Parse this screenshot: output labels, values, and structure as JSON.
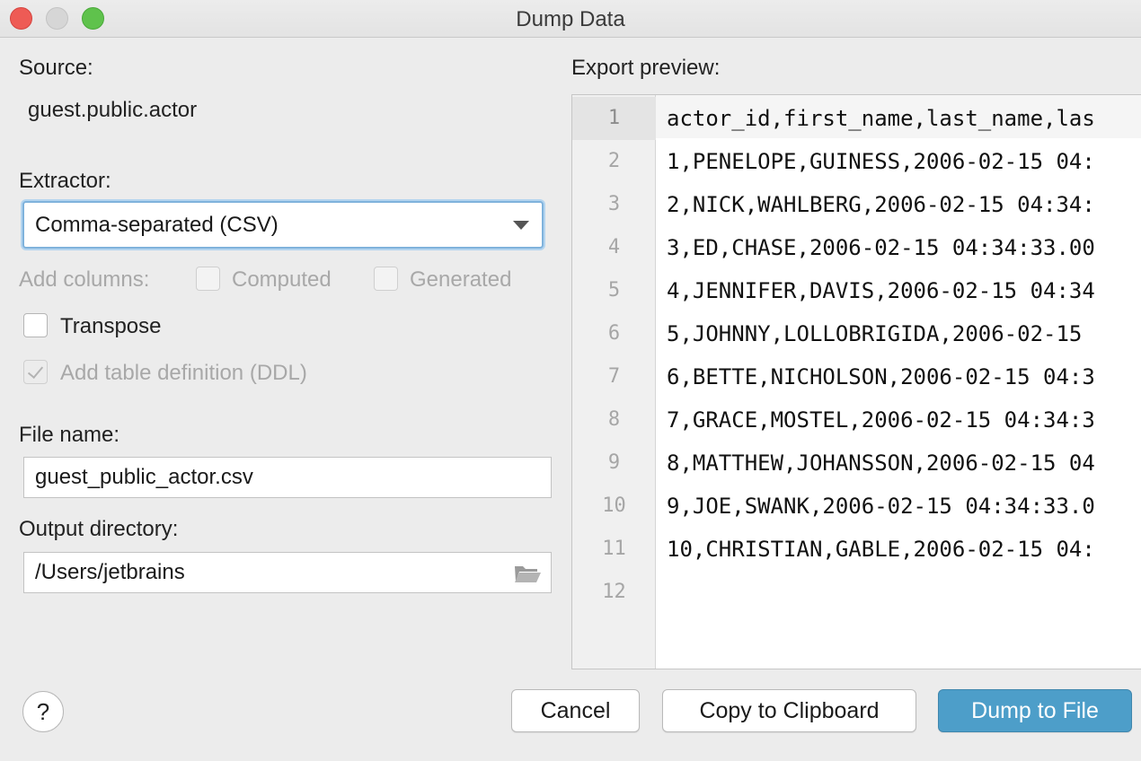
{
  "window": {
    "title": "Dump Data"
  },
  "source": {
    "label": "Source:",
    "value": "guest.public.actor"
  },
  "extractor": {
    "label": "Extractor:",
    "selected": "Comma-separated (CSV)"
  },
  "add_columns": {
    "label": "Add columns:",
    "computed": "Computed",
    "generated": "Generated"
  },
  "options": {
    "transpose": "Transpose",
    "add_ddl": "Add table definition (DDL)"
  },
  "file_name": {
    "label": "File name:",
    "value": "guest_public_actor.csv"
  },
  "output_dir": {
    "label": "Output directory:",
    "value": "/Users/jetbrains"
  },
  "preview": {
    "label": "Export preview:",
    "lines": [
      {
        "n": "1",
        "text": "actor_id,first_name,last_name,las"
      },
      {
        "n": "2",
        "text": "1,PENELOPE,GUINESS,2006-02-15 04:"
      },
      {
        "n": "3",
        "text": "2,NICK,WAHLBERG,2006-02-15 04:34:"
      },
      {
        "n": "4",
        "text": "3,ED,CHASE,2006-02-15 04:34:33.00"
      },
      {
        "n": "5",
        "text": "4,JENNIFER,DAVIS,2006-02-15 04:34"
      },
      {
        "n": "6",
        "text": "5,JOHNNY,LOLLOBRIGIDA,2006-02-15"
      },
      {
        "n": "7",
        "text": "6,BETTE,NICHOLSON,2006-02-15 04:3"
      },
      {
        "n": "8",
        "text": "7,GRACE,MOSTEL,2006-02-15 04:34:3"
      },
      {
        "n": "9",
        "text": "8,MATTHEW,JOHANSSON,2006-02-15 04"
      },
      {
        "n": "10",
        "text": "9,JOE,SWANK,2006-02-15 04:34:33.0"
      },
      {
        "n": "11",
        "text": "10,CHRISTIAN,GABLE,2006-02-15 04:"
      },
      {
        "n": "12",
        "text": ""
      }
    ]
  },
  "buttons": {
    "help": "?",
    "cancel": "Cancel",
    "copy": "Copy to Clipboard",
    "dump": "Dump to File"
  }
}
